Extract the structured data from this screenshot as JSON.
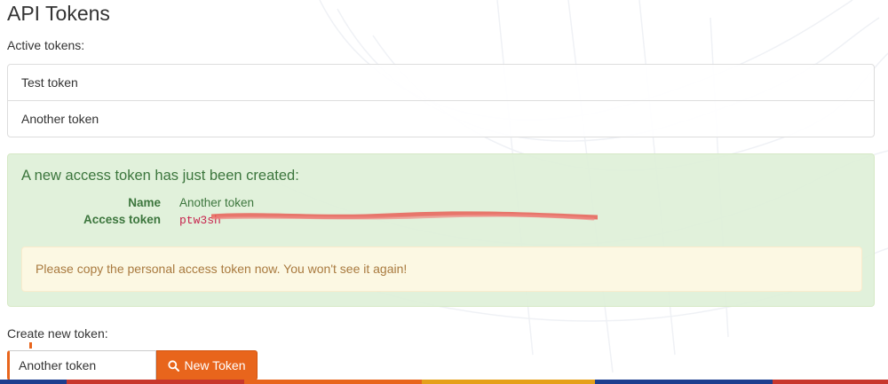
{
  "page": {
    "title": "API Tokens"
  },
  "active_tokens": {
    "label": "Active tokens:",
    "items": [
      {
        "name": "Test token"
      },
      {
        "name": "Another token"
      }
    ]
  },
  "new_token_alert": {
    "heading": "A new access token has just been created:",
    "name_label": "Name",
    "name_value": "Another token",
    "token_label": "Access token",
    "token_value": "ptw3sh",
    "warning": "Please copy the personal access token now. You won't see it again!"
  },
  "create_form": {
    "label": "Create new token:",
    "input_value": "Another token",
    "button_label": "New Token",
    "button_icon": "search-icon"
  },
  "colors": {
    "accent": "#e8651c",
    "success_bg": "#dff0d8",
    "success_text": "#3c763d",
    "warning_bg": "#fcf8e3",
    "warning_text": "#a97a3f",
    "token_code": "#c7254e",
    "redaction": "#e8574f",
    "footer_stripes": [
      "#1d3f8f",
      "#c8372d",
      "#e8651c",
      "#e5a01a",
      "#1d3f8f",
      "#c8372d"
    ]
  }
}
